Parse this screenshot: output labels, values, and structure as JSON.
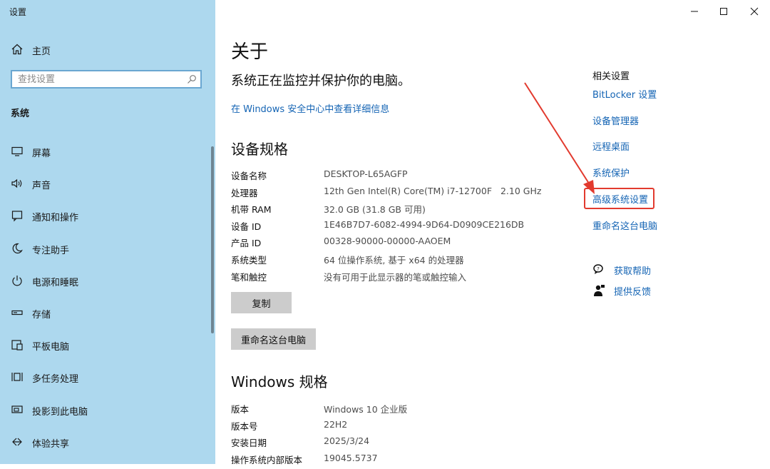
{
  "app": {
    "title": "设置"
  },
  "sidebar": {
    "home_label": "主页",
    "search_placeholder": "查找设置",
    "section_label": "系统",
    "items": [
      {
        "label": "屏幕",
        "icon": "monitor-icon"
      },
      {
        "label": "声音",
        "icon": "speaker-icon"
      },
      {
        "label": "通知和操作",
        "icon": "notification-icon"
      },
      {
        "label": "专注助手",
        "icon": "moon-icon"
      },
      {
        "label": "电源和睡眠",
        "icon": "power-icon"
      },
      {
        "label": "存储",
        "icon": "storage-icon"
      },
      {
        "label": "平板电脑",
        "icon": "tablet-icon"
      },
      {
        "label": "多任务处理",
        "icon": "multitask-icon"
      },
      {
        "label": "投影到此电脑",
        "icon": "project-icon"
      },
      {
        "label": "体验共享",
        "icon": "share-icon"
      }
    ]
  },
  "main": {
    "title": "关于",
    "status": "系统正在监控并保护你的电脑。",
    "security_link": "在 Windows 安全中心中查看详细信息",
    "device_heading": "设备规格",
    "device_specs": [
      {
        "key": "设备名称",
        "value": "DESKTOP-L65AGFP"
      },
      {
        "key": "处理器",
        "value": "12th Gen Intel(R) Core(TM) i7-12700F   2.10 GHz"
      },
      {
        "key": "机带 RAM",
        "value": "32.0 GB (31.8 GB 可用)"
      },
      {
        "key": "设备 ID",
        "value": "1E46B7D7-6082-4994-9D64-D0909CE216DB"
      },
      {
        "key": "产品 ID",
        "value": "00328-90000-00000-AAOEM"
      },
      {
        "key": "系统类型",
        "value": "64 位操作系统, 基于 x64 的处理器"
      },
      {
        "key": "笔和触控",
        "value": "没有可用于此显示器的笔或触控输入"
      }
    ],
    "copy_button": "复制",
    "rename_button": "重命名这台电脑",
    "windows_heading": "Windows 规格",
    "windows_specs": [
      {
        "key": "版本",
        "value": "Windows 10 企业版"
      },
      {
        "key": "版本号",
        "value": "22H2"
      },
      {
        "key": "安装日期",
        "value": "2025/3/24"
      },
      {
        "key": "操作系统内部版本",
        "value": "19045.5737"
      }
    ]
  },
  "related": {
    "title": "相关设置",
    "links": [
      "BitLocker 设置",
      "设备管理器",
      "远程桌面",
      "系统保护",
      "高级系统设置",
      "重命名这台电脑"
    ],
    "help": {
      "label": "获取帮助",
      "icon": "help-chat-icon"
    },
    "feedback": {
      "label": "提供反馈",
      "icon": "feedback-icon"
    }
  },
  "window_controls": [
    "minimize-icon",
    "maximize-icon",
    "close-icon"
  ],
  "colors": {
    "sidebar_bg": "#add8ee",
    "link": "#1464b4",
    "highlight": "#e23a2e",
    "button_bg": "#cccccc"
  }
}
